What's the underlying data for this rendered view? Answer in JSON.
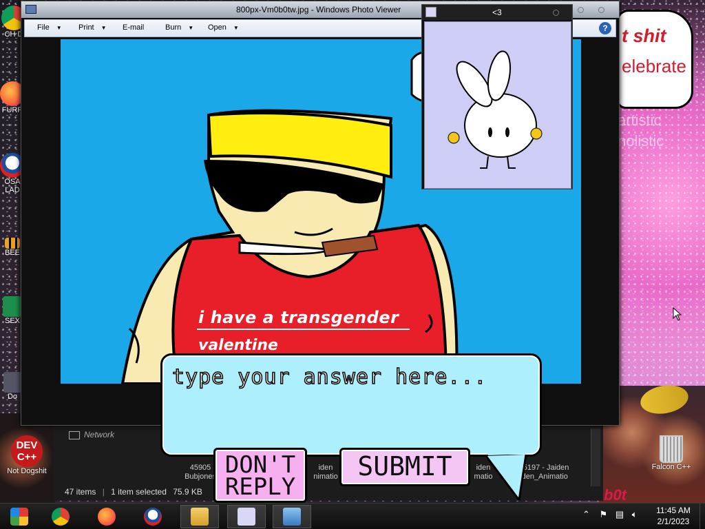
{
  "desktop": {
    "icons": [
      {
        "label": "CH D",
        "icon": "chrome-icon"
      },
      {
        "label": "FURR",
        "icon": "firefox-icon"
      },
      {
        "label": "OSA LAD",
        "icon": "obama-icon"
      },
      {
        "label": "BEE",
        "icon": "bee-icon"
      },
      {
        "label": "SEX",
        "icon": "excel-icon"
      },
      {
        "label": "Do",
        "icon": "doc-icon"
      },
      {
        "label": "Not Dogshit",
        "icon": "dev-cpp-icon",
        "badge": "DEV C++"
      },
      {
        "label": "Falcon C++",
        "icon": "recycle-bin-icon"
      }
    ],
    "wallpaper_text": {
      "line1": "t shit",
      "line2": "elebrate",
      "side1": "artistic",
      "side2": "nolistic",
      "bottom": "b0t"
    }
  },
  "photo_viewer": {
    "title": "800px-Vm0b0tw.jpg - Windows Photo Viewer",
    "menu": [
      {
        "label": "File",
        "dropdown": true
      },
      {
        "label": "Print",
        "dropdown": true
      },
      {
        "label": "E-mail",
        "dropdown": false
      },
      {
        "label": "Burn",
        "dropdown": true
      },
      {
        "label": "Open",
        "dropdown": true
      }
    ],
    "help": "?",
    "image_caption": {
      "line1": "i have a transgender",
      "line2": "valentine"
    }
  },
  "explorer": {
    "nav_item": "Network",
    "thumbnails": [
      {
        "line1": "45905",
        "line2": "Bubjones"
      },
      {
        "line1": "iden",
        "line2": "nimatio"
      },
      {
        "line1": "iden",
        "line2": "matio"
      },
      {
        "line1": "55197 - Jaiden",
        "line2": "iden_Animatio"
      }
    ],
    "status": {
      "items": "47 items",
      "selected": "1 item selected",
      "size": "75.9 KB"
    }
  },
  "sticker_window": {
    "title": "<3"
  },
  "answer_dialog": {
    "placeholder": "type your answer here...",
    "dont_reply": "DON'T REPLY",
    "submit": "SUBMIT",
    "bg_color": "#adeffc"
  },
  "taskbar": {
    "apps": [
      "bing-maps-icon",
      "chrome-icon",
      "firefox-icon",
      "obama-icon",
      "file-explorer-icon",
      "bunny-icon",
      "photo-viewer-icon"
    ],
    "time": "11:45 AM",
    "date": "2/1/2023"
  }
}
